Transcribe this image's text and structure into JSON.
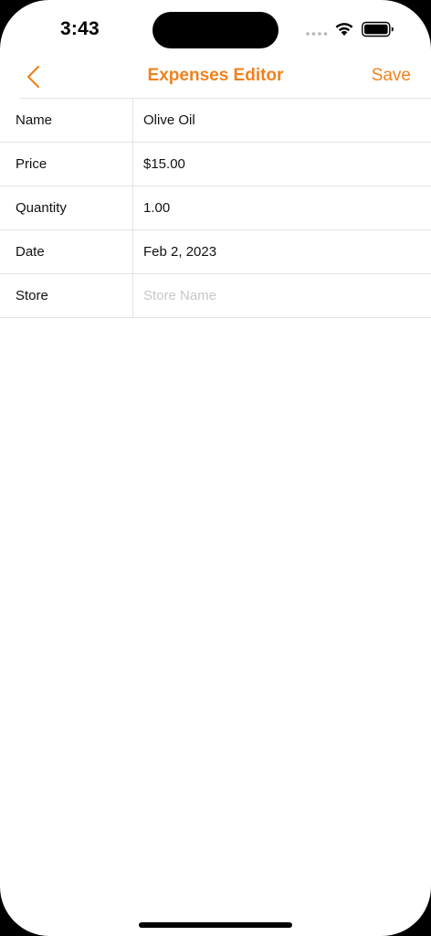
{
  "status_bar": {
    "time": "3:43"
  },
  "nav": {
    "title": "Expenses Editor",
    "save_label": "Save",
    "back_icon": "chevron-left-icon"
  },
  "form": {
    "rows": [
      {
        "label": "Name",
        "value": "Olive Oil"
      },
      {
        "label": "Price",
        "value": "$15.00"
      },
      {
        "label": "Quantity",
        "value": "1.00"
      },
      {
        "label": "Date",
        "value": "Feb 2, 2023"
      },
      {
        "label": "Store",
        "value": "",
        "placeholder": "Store Name"
      }
    ]
  },
  "colors": {
    "accent": "#f1811f",
    "separator": "#e3e3e3",
    "placeholder": "#c7c7cc"
  }
}
